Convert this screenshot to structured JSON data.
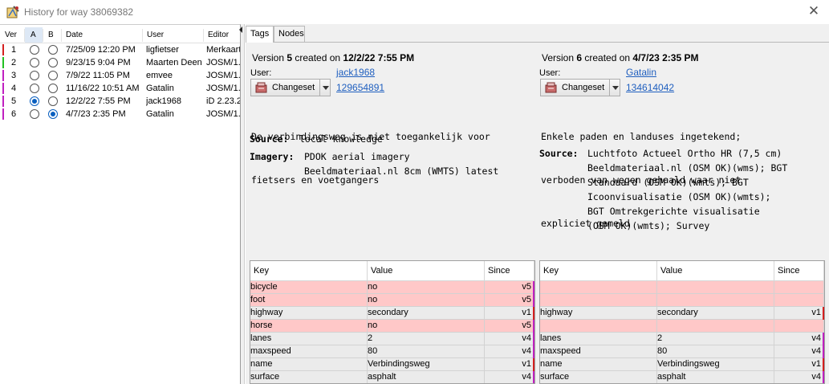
{
  "window": {
    "title": "History for way 38069382"
  },
  "versions": {
    "headers": {
      "ver": "Ver",
      "a": "A",
      "b": "B",
      "date": "Date",
      "user": "User",
      "editor": "Editor"
    },
    "rows": [
      {
        "ver": "1",
        "date": "7/25/09 12:20 PM",
        "user": "ligfietser",
        "editor": "Merkaart",
        "color": "#d42020",
        "a": false,
        "b": false
      },
      {
        "ver": "2",
        "date": "9/23/15 9:04 PM",
        "user": "Maarten Deen",
        "editor": "JOSM/1.",
        "color": "#22c022",
        "a": false,
        "b": false
      },
      {
        "ver": "3",
        "date": "7/9/22 11:05 PM",
        "user": "emvee",
        "editor": "JOSM/1.",
        "color": "#c020c0",
        "a": false,
        "b": false
      },
      {
        "ver": "4",
        "date": "11/16/22 10:51 AM",
        "user": "Gatalin",
        "editor": "JOSM/1.",
        "color": "#c020c0",
        "a": false,
        "b": false
      },
      {
        "ver": "5",
        "date": "12/2/22 7:55 PM",
        "user": "jack1968",
        "editor": "iD 2.23.2",
        "color": "#c020c0",
        "a": true,
        "b": false
      },
      {
        "ver": "6",
        "date": "4/7/23 2:35 PM",
        "user": "Gatalin",
        "editor": "JOSM/1.",
        "color": "#c020c0",
        "a": false,
        "b": true
      }
    ]
  },
  "tabs": [
    {
      "label": "Tags",
      "active": true
    },
    {
      "label": "Nodes",
      "active": false
    }
  ],
  "left_version": {
    "prefix": "Version ",
    "number": "5",
    "created_on": " created on ",
    "date": "12/2/22 7:55 PM",
    "user_label": "User:",
    "user": "jack1968",
    "changeset_label": "Changeset",
    "changeset_id": "129654891",
    "comment_lines": [
      "De verbindingsweg is niet toegankelijk voor",
      "fietsers en voetgangers"
    ],
    "source_key": "Source:",
    "source_lines": [
      "local knowledge"
    ],
    "imagery_key": "Imagery:",
    "imagery_lines": [
      "PDOK aerial imagery",
      "Beeldmateriaal.nl 8cm (WMTS) latest"
    ]
  },
  "right_version": {
    "prefix": "Version ",
    "number": "6",
    "created_on": " created on ",
    "date": "4/7/23 2:35 PM",
    "user_label": "User:",
    "user": "Gatalin",
    "changeset_label": "Changeset",
    "changeset_id": "134614042",
    "comment_lines": [
      "Enkele paden en landuses ingetekend;",
      "verboden van wegen gehaald waar niet",
      "expliciet gemeld"
    ],
    "source_key": "Source:",
    "source_lines": [
      "Luchtfoto Actueel Ortho HR (7,5 cm)",
      "Beeldmateriaal.nl (OSM OK)(wms); BGT",
      "Standaard (OSM OK)(wmts); BGT",
      "Icoonvisualisatie (OSM OK)(wmts);",
      "BGT Omtrekgerichte visualisatie",
      "(OSM OK)(wmts); Survey"
    ]
  },
  "tag_table_headers": {
    "key": "Key",
    "value": "Value",
    "since": "Since"
  },
  "left_tags": [
    {
      "key": "bicycle",
      "value": "no",
      "since": "v5",
      "state": "diff",
      "bar": "#c020c0"
    },
    {
      "key": "foot",
      "value": "no",
      "since": "v5",
      "state": "diff",
      "bar": "#c020c0"
    },
    {
      "key": "highway",
      "value": "secondary",
      "since": "v1",
      "state": "same",
      "bar": "#d42020"
    },
    {
      "key": "horse",
      "value": "no",
      "since": "v5",
      "state": "diff",
      "bar": "#c020c0"
    },
    {
      "key": "lanes",
      "value": "2",
      "since": "v4",
      "state": "same",
      "bar": "#c020c0"
    },
    {
      "key": "maxspeed",
      "value": "80",
      "since": "v4",
      "state": "same",
      "bar": "#c020c0"
    },
    {
      "key": "name",
      "value": "Verbindingsweg",
      "since": "v1",
      "state": "same",
      "bar": "#d42020"
    },
    {
      "key": "surface",
      "value": "asphalt",
      "since": "v4",
      "state": "same",
      "bar": "#c020c0"
    }
  ],
  "right_tags": [
    {
      "key": "",
      "value": "",
      "since": "",
      "state": "diff",
      "bar": ""
    },
    {
      "key": "",
      "value": "",
      "since": "",
      "state": "diff",
      "bar": ""
    },
    {
      "key": "highway",
      "value": "secondary",
      "since": "v1",
      "state": "same",
      "bar": "#d42020"
    },
    {
      "key": "",
      "value": "",
      "since": "",
      "state": "diff",
      "bar": ""
    },
    {
      "key": "lanes",
      "value": "2",
      "since": "v4",
      "state": "same",
      "bar": "#c020c0"
    },
    {
      "key": "maxspeed",
      "value": "80",
      "since": "v4",
      "state": "same",
      "bar": "#c020c0"
    },
    {
      "key": "name",
      "value": "Verbindingsweg",
      "since": "v1",
      "state": "same",
      "bar": "#d42020"
    },
    {
      "key": "surface",
      "value": "asphalt",
      "since": "v4",
      "state": "same",
      "bar": "#c020c0"
    }
  ]
}
